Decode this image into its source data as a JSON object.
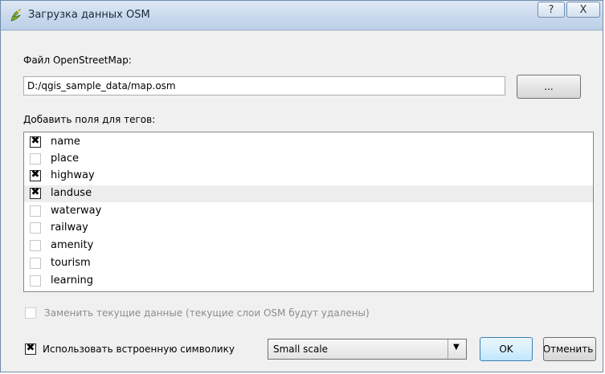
{
  "window": {
    "title": "Загрузка данных OSM",
    "help_label": "?",
    "close_label": "X"
  },
  "file": {
    "label": "Файл OpenStreetMap:",
    "value": "D:/qgis_sample_data/map.osm",
    "browse_label": "..."
  },
  "tags": {
    "label": "Добавить поля для тегов:",
    "items": [
      {
        "label": "name",
        "checked": true
      },
      {
        "label": "place",
        "checked": false
      },
      {
        "label": "highway",
        "checked": true
      },
      {
        "label": "landuse",
        "checked": true
      },
      {
        "label": "waterway",
        "checked": false
      },
      {
        "label": "railway",
        "checked": false
      },
      {
        "label": "amenity",
        "checked": false
      },
      {
        "label": "tourism",
        "checked": false
      },
      {
        "label": "learning",
        "checked": false
      }
    ]
  },
  "replace": {
    "label": "Заменить текущие данные (текущие слои OSM будут удалены)",
    "checked": false,
    "enabled": false
  },
  "symbology": {
    "label": "Использовать встроенную символику",
    "checked": true,
    "scale_value": "Small scale"
  },
  "buttons": {
    "ok_label": "OK",
    "cancel_label": "Отменить"
  },
  "colors": {
    "title_bar": "#c9d9ec",
    "dialog_bg": "#f0f0f0",
    "list_highlight": "#ededed",
    "disabled_text": "#8d8d8d"
  }
}
